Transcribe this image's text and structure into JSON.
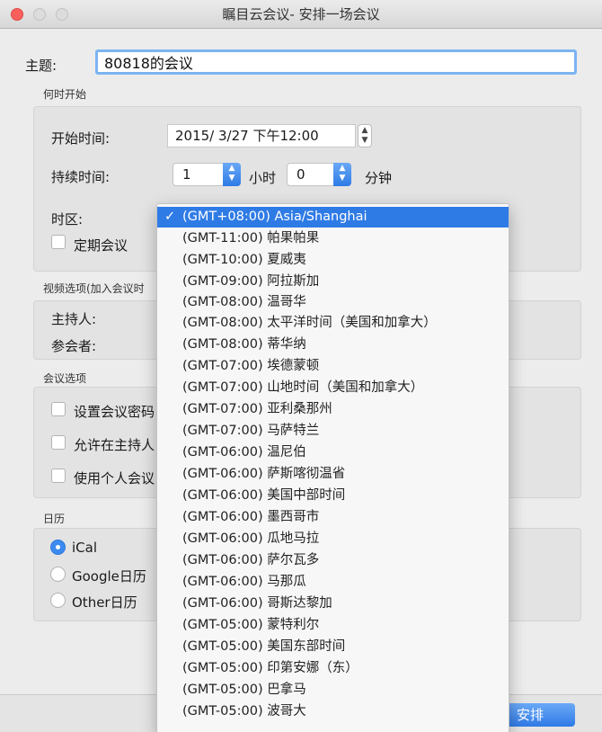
{
  "window": {
    "title": "瞩目云会议- 安排一场会议"
  },
  "subject": {
    "label": "主题:",
    "value": "80818的会议"
  },
  "when": {
    "section_label": "何时开始",
    "start_label": "开始时间:",
    "start_value": "2015/  3/27 下午12:00",
    "duration_label": "持续时间:",
    "hours_value": "1",
    "hours_unit": "小时",
    "minutes_value": "0",
    "minutes_unit": "分钟",
    "timezone_label": "时区:",
    "recurring_label": "定期会议"
  },
  "video": {
    "section_label": "视频选项(加入会议时",
    "host_label": "主持人:",
    "participants_label": "参会者:"
  },
  "meeting_options": {
    "section_label": "会议选项",
    "opt1_label": "设置会议密码",
    "opt2_label": "允许在主持人",
    "opt3_label": "使用个人会议"
  },
  "calendar": {
    "section_label": "日历",
    "options": [
      {
        "label": "iCal",
        "selected": true
      },
      {
        "label": "Google日历",
        "selected": false
      },
      {
        "label": "Other日历",
        "selected": false
      }
    ]
  },
  "footer": {
    "schedule_label": "安排"
  },
  "timezone_menu": {
    "selected_mark": "✓",
    "items": [
      "(GMT+08:00) Asia/Shanghai",
      "(GMT-11:00) 帕果帕果",
      "(GMT-10:00) 夏威夷",
      "(GMT-09:00) 阿拉斯加",
      "(GMT-08:00) 温哥华",
      "(GMT-08:00) 太平洋时间（美国和加拿大）",
      "(GMT-08:00) 蒂华纳",
      "(GMT-07:00) 埃德蒙顿",
      "(GMT-07:00) 山地时间（美国和加拿大）",
      "(GMT-07:00) 亚利桑那州",
      "(GMT-07:00) 马萨特兰",
      "(GMT-06:00) 温尼伯",
      "(GMT-06:00) 萨斯喀彻温省",
      "(GMT-06:00) 美国中部时间",
      "(GMT-06:00) 墨西哥市",
      "(GMT-06:00) 瓜地马拉",
      "(GMT-06:00) 萨尔瓦多",
      "(GMT-06:00) 马那瓜",
      "(GMT-06:00) 哥斯达黎加",
      "(GMT-05:00) 蒙特利尔",
      "(GMT-05:00) 美国东部时间",
      "(GMT-05:00) 印第安娜（东）",
      "(GMT-05:00) 巴拿马",
      "(GMT-05:00) 波哥大"
    ]
  }
}
